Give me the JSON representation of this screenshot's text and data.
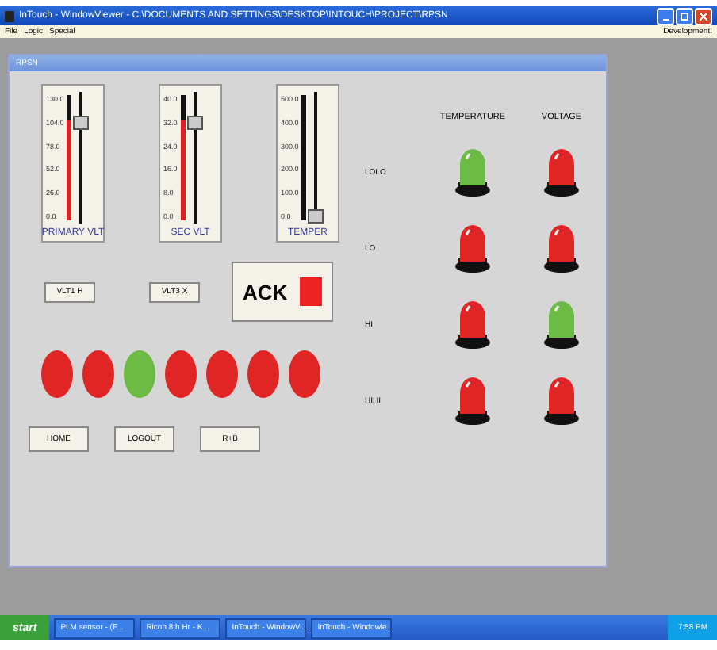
{
  "window": {
    "title": "InTouch - WindowViewer - C:\\DOCUMENTS AND SETTINGS\\DESKTOP\\INTOUCH\\PROJECT\\RPSN"
  },
  "menu": [
    "File",
    "Logic",
    "Special"
  ],
  "menu_right": "Development!",
  "panel": {
    "title": "RPSN"
  },
  "sliders": [
    {
      "label": "PRIMARY VLT",
      "ticks": [
        "130.0",
        "104.0",
        "78.0",
        "52.0",
        "26.0",
        "0.0"
      ],
      "level": 0.8
    },
    {
      "label": "SEC VLT",
      "ticks": [
        "40.0",
        "32.0",
        "24.0",
        "16.0",
        "8.0",
        "0.0"
      ],
      "level": 0.8
    },
    {
      "label": "TEMPER",
      "ticks": [
        "500.0",
        "400.0",
        "300.0",
        "200.0",
        "100.0",
        "0.0"
      ],
      "level": 0
    }
  ],
  "vlt_buttons": [
    "VLT1 H",
    "VLT3 X"
  ],
  "ack": {
    "label": "ACK",
    "color": "#ee2222"
  },
  "lamps": [
    {
      "color": "#e02525"
    },
    {
      "color": "#e02525"
    },
    {
      "color": "#6cbb44"
    },
    {
      "color": "#e02525"
    },
    {
      "color": "#e02525"
    },
    {
      "color": "#e02525"
    },
    {
      "color": "#e02525"
    }
  ],
  "nav_buttons": [
    "HOME",
    "LOGOUT",
    "R+B"
  ],
  "alarm_columns": [
    "TEMPERATURE",
    "VOLTAGE"
  ],
  "alarm_rows": [
    {
      "label": "LOLO",
      "lamps": [
        {
          "color": "#6cbb44"
        },
        {
          "color": "#e02525"
        }
      ]
    },
    {
      "label": "LO",
      "lamps": [
        {
          "color": "#e02525"
        },
        {
          "color": "#e02525"
        }
      ]
    },
    {
      "label": "HI",
      "lamps": [
        {
          "color": "#e02525"
        },
        {
          "color": "#6cbb44"
        }
      ]
    },
    {
      "label": "HIHI",
      "lamps": [
        {
          "color": "#e02525"
        },
        {
          "color": "#e02525"
        }
      ]
    }
  ],
  "taskbar": {
    "start": "start",
    "items": [
      "PLM sensor - (F...",
      "Ricoh 8th Hr - K...",
      "InTouch - WindowVi...",
      "InTouch - Windowle..."
    ],
    "clock": "7:58 PM"
  }
}
